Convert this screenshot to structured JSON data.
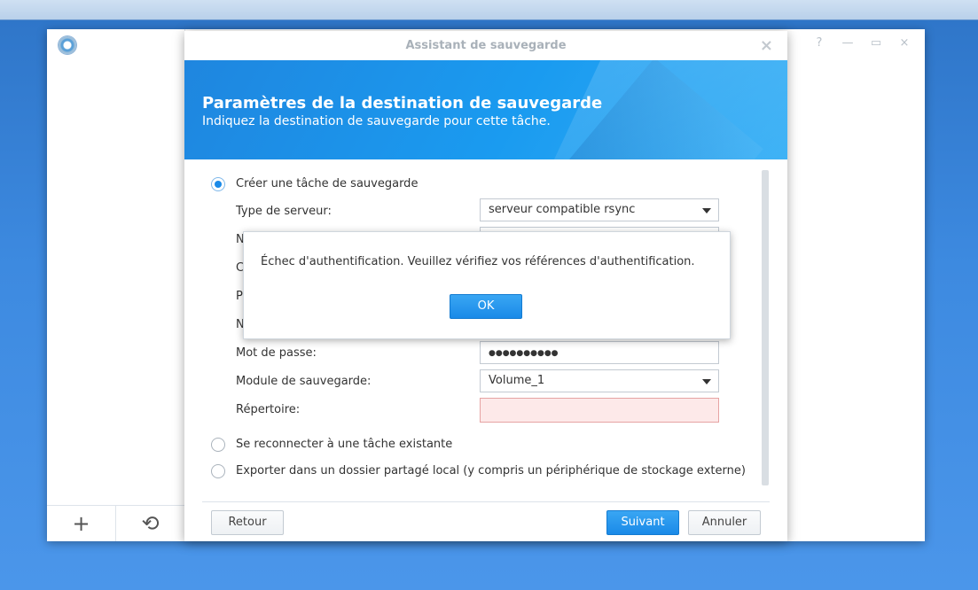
{
  "dialog": {
    "title": "Assistant de sauvegarde",
    "close_icon": "×"
  },
  "window_controls": {
    "help": "?",
    "minimize": "—",
    "maximize": "▭",
    "close": "×"
  },
  "banner": {
    "heading": "Paramètres de la destination de sauvegarde",
    "subtitle": "Indiquez la destination de sauvegarde pour cette tâche."
  },
  "options": {
    "create": "Créer une tâche de sauvegarde",
    "reconnect": "Se reconnecter à une tâche existante",
    "export": "Exporter dans un dossier partagé local (y compris un périphérique de stockage externe)"
  },
  "form": {
    "server_type_label": "Type de serveur:",
    "server_type_value": "serveur compatible rsync",
    "hidden_label_1": "N",
    "hidden_label_2": "C",
    "hidden_label_3": "P",
    "hidden_label_4": "N",
    "password_label": "Mot de passe:",
    "password_value": "●●●●●●●●●●",
    "module_label": "Module de sauvegarde:",
    "module_value": "Volume_1",
    "directory_label": "Répertoire:",
    "directory_value": ""
  },
  "buttons": {
    "back": "Retour",
    "next": "Suivant",
    "cancel": "Annuler"
  },
  "alert": {
    "message": "Échec d'authentification. Veuillez vérifiez vos références d'authentification.",
    "ok": "OK"
  },
  "sidebar": {
    "add_icon": "+",
    "history_icon": "⟲"
  }
}
